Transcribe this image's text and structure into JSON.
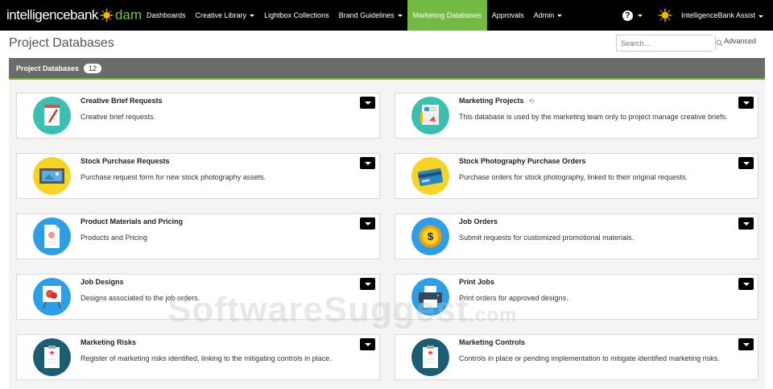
{
  "brand": {
    "name": "intelligencebank",
    "product": "dam"
  },
  "nav": [
    {
      "label": "Dashboards",
      "dropdown": false,
      "active": false
    },
    {
      "label": "Creative Library",
      "dropdown": true,
      "active": false
    },
    {
      "label": "Lightbox Collections",
      "dropdown": false,
      "active": false
    },
    {
      "label": "Brand Guidelines",
      "dropdown": true,
      "active": false
    },
    {
      "label": "Marketing Databases",
      "dropdown": false,
      "active": true
    },
    {
      "label": "Approvals",
      "dropdown": false,
      "active": false
    },
    {
      "label": "Admin",
      "dropdown": true,
      "active": false
    }
  ],
  "user": {
    "name": "IntelligenceBank Assist"
  },
  "page": {
    "title": "Project Databases"
  },
  "search": {
    "placeholder": "Search...",
    "advanced_label": "Advanced"
  },
  "panel": {
    "title": "Project Databases",
    "count": "12"
  },
  "cards": [
    {
      "title": "Creative Brief Requests",
      "desc": "Creative brief requests.",
      "icon": "notepad-pen-icon"
    },
    {
      "title": "Marketing Projects",
      "desc": "This database is used by the marketing team only to project manage creative briefs.",
      "icon": "presentation-board-icon",
      "synced": true
    },
    {
      "title": "Stock Purchase Requests",
      "desc": "Purchase request form for new stock photography assets.",
      "icon": "photo-frame-icon"
    },
    {
      "title": "Stock Photography Purchase Orders",
      "desc": "Purchase orders for stock photography, linked to their original requests.",
      "icon": "credit-card-icon"
    },
    {
      "title": "Product Materials and Pricing",
      "desc": "Products and Pricing",
      "icon": "document-icon"
    },
    {
      "title": "Job Orders",
      "desc": "Submit requests for customized promotional materials.",
      "icon": "dollar-coin-icon"
    },
    {
      "title": "Job Designs",
      "desc": "Designs associated to the job orders.",
      "icon": "easel-icon"
    },
    {
      "title": "Print Jobs",
      "desc": "Print orders for approved designs.",
      "icon": "printer-icon"
    },
    {
      "title": "Marketing Risks",
      "desc": "Register of marketing risks identified, linking to the mitigating controls in place.",
      "icon": "clipboard-plus-icon"
    },
    {
      "title": "Marketing Controls",
      "desc": "Controls in place or pending implementation to mitigate identified marketing risks.",
      "icon": "clipboard-plus-icon"
    }
  ],
  "watermark": {
    "text": "SoftwareSuggest",
    "suffix": ".com"
  },
  "colors": {
    "accent": "#73b944",
    "topbar": "#000000",
    "panel_header": "#6b6b6b"
  }
}
